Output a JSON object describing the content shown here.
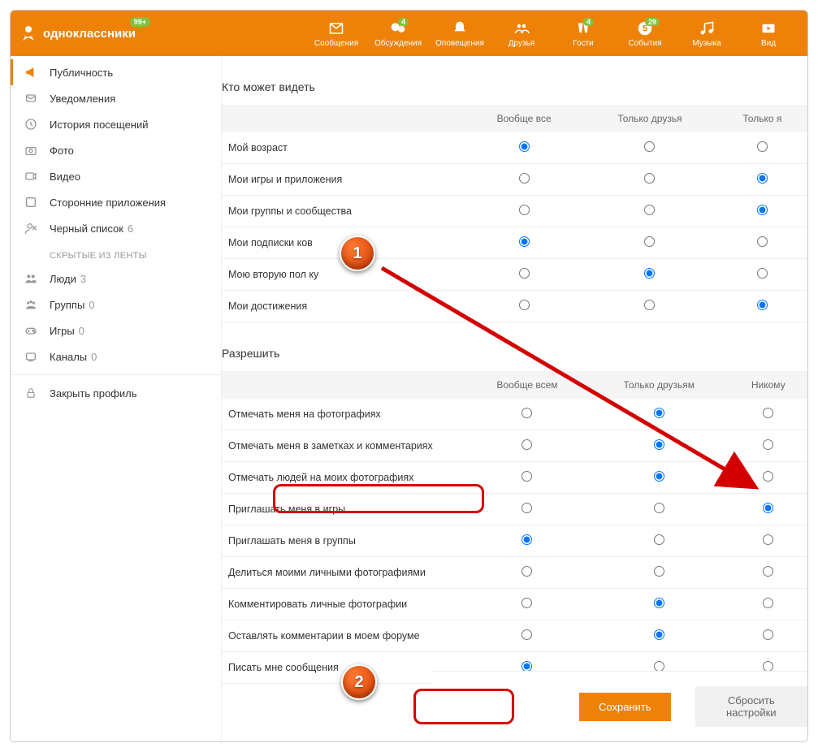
{
  "brand": "одноклассники",
  "brand_badge": "99+",
  "nav": [
    {
      "id": "messages",
      "label": "Сообщения"
    },
    {
      "id": "discussions",
      "label": "Обсуждения",
      "badge": "4"
    },
    {
      "id": "notifications",
      "label": "Оповещения"
    },
    {
      "id": "friends",
      "label": "Друзья"
    },
    {
      "id": "guests",
      "label": "Гости",
      "badge": "4"
    },
    {
      "id": "events",
      "label": "События",
      "badge": "29"
    },
    {
      "id": "music",
      "label": "Музыка"
    },
    {
      "id": "video",
      "label": "Вид"
    }
  ],
  "sidebar": {
    "items": [
      {
        "id": "publicity",
        "label": "Публичность",
        "active": true
      },
      {
        "id": "notifications",
        "label": "Уведомления"
      },
      {
        "id": "history",
        "label": "История посещений"
      },
      {
        "id": "photo",
        "label": "Фото"
      },
      {
        "id": "video",
        "label": "Видео"
      },
      {
        "id": "apps",
        "label": "Сторонние приложения"
      },
      {
        "id": "blacklist",
        "label": "Черный список",
        "count": "6"
      }
    ],
    "hidden_heading": "СКРЫТЫЕ ИЗ ЛЕНТЫ",
    "hidden": [
      {
        "id": "people",
        "label": "Люди",
        "count": "3"
      },
      {
        "id": "groups",
        "label": "Группы",
        "count": "0"
      },
      {
        "id": "games",
        "label": "Игры",
        "count": "0"
      },
      {
        "id": "channels",
        "label": "Каналы",
        "count": "0"
      }
    ],
    "close_profile": "Закрыть профиль"
  },
  "sections": {
    "see": {
      "title": "Кто может видеть",
      "cols": [
        "Вообще все",
        "Только друзья",
        "Только я"
      ],
      "rows": [
        {
          "label": "Мой возраст",
          "sel": 0
        },
        {
          "label": "Мои игры и приложения",
          "sel": 2
        },
        {
          "label": "Мои группы и сообщества",
          "sel": 2
        },
        {
          "label": "Мои подписки             ков",
          "sel": 0
        },
        {
          "label": "Мою вторую пол           ку",
          "sel": 1
        },
        {
          "label": "Мои достижения",
          "sel": 2
        }
      ]
    },
    "allow": {
      "title": "Разрешить",
      "cols": [
        "Вообще всем",
        "Только друзьям",
        "Никому"
      ],
      "rows": [
        {
          "label": "Отмечать меня на фотографиях",
          "sel": 1
        },
        {
          "label": "Отмечать меня в заметках и комментариях",
          "sel": 1
        },
        {
          "label": "Отмечать людей на моих фотографиях",
          "sel": 1
        },
        {
          "label": "Приглашать меня в игры",
          "sel": 2,
          "highlight": true
        },
        {
          "label": "Приглашать меня в группы",
          "sel": 0
        },
        {
          "label": "Делиться моими личными фотографиями",
          "sel": null
        },
        {
          "label": "Комментировать личные фотографии",
          "sel": 1
        },
        {
          "label": "Оставлять комментарии в моем форуме",
          "sel": 1
        },
        {
          "label": "Писать мне сообщения",
          "sel": 0
        }
      ]
    }
  },
  "buttons": {
    "save": "Сохранить",
    "reset": "Сбросить настройки"
  },
  "annotations": {
    "step1": "1",
    "step2": "2"
  }
}
